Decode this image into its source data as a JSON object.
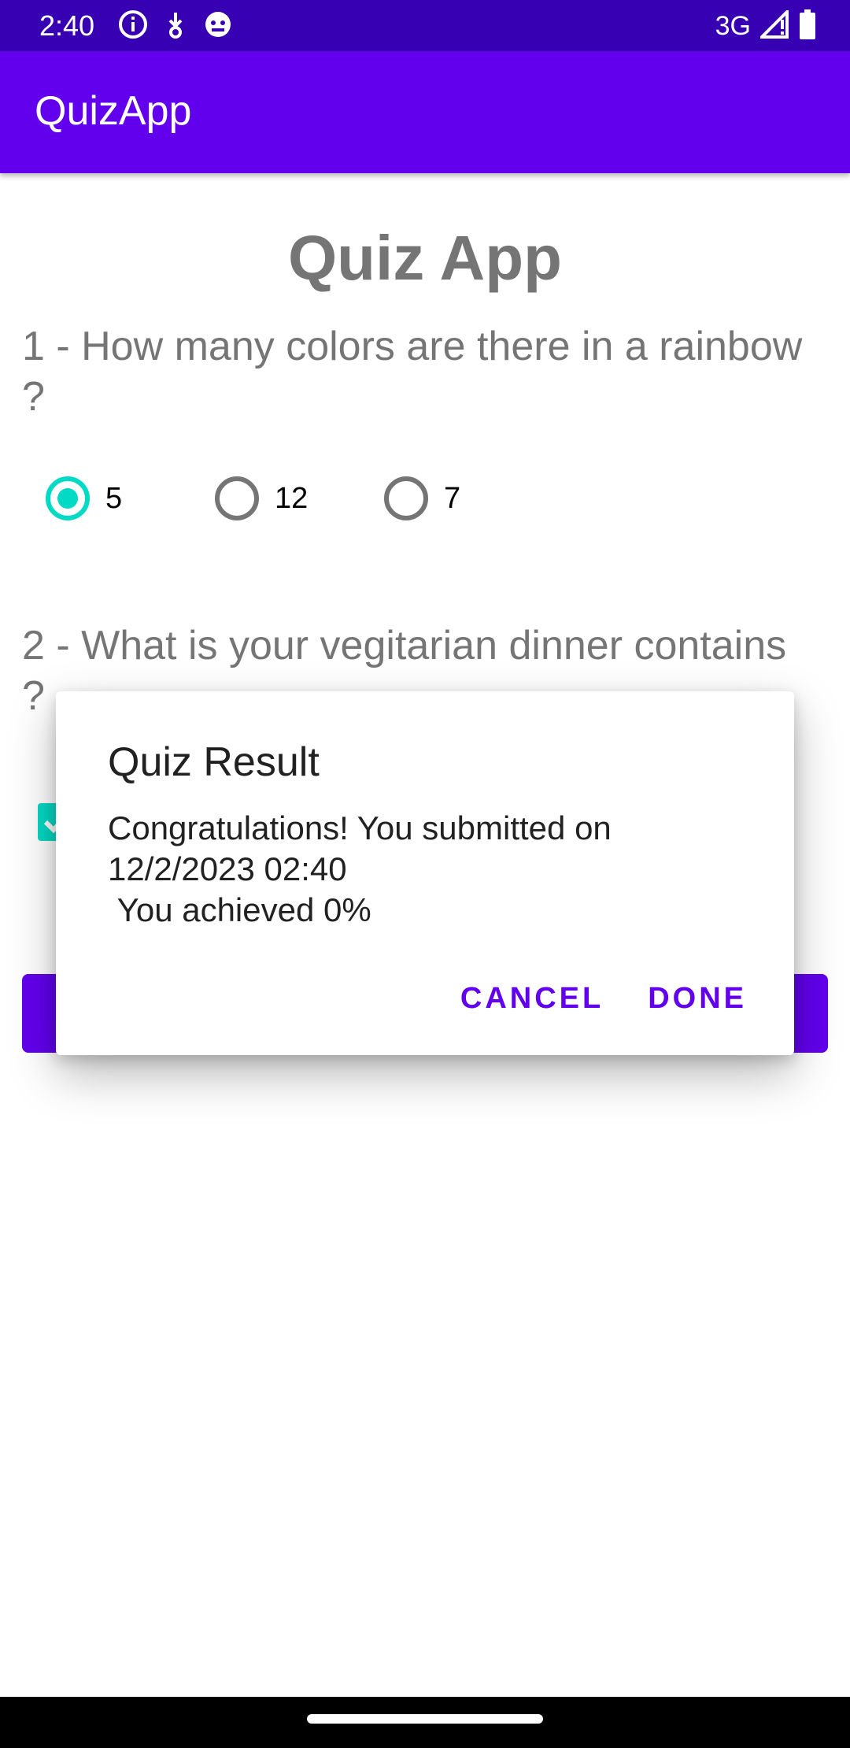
{
  "status_bar": {
    "time": "2:40",
    "network": "3G",
    "icons": [
      "info-icon",
      "download-icon",
      "android-debug-icon",
      "signal-icon",
      "battery-icon"
    ]
  },
  "app_bar": {
    "title": "QuizApp"
  },
  "main": {
    "heading": "Quiz App",
    "question1": {
      "text": "1 - How many colors are there in a rainbow ?",
      "options": [
        "5",
        "12",
        "7"
      ],
      "selected": "5"
    },
    "question2": {
      "text": "2 - What is your vegitarian dinner contains ?"
    }
  },
  "dialog": {
    "title": "Quiz Result",
    "message": "Congratulations! You submitted on\n12/2/2023 02:40\n You achieved 0%",
    "cancel_label": "CANCEL",
    "done_label": "DONE"
  },
  "colors": {
    "primary": "#6200ee",
    "primary_dark": "#3700b3",
    "accent": "#03dac5",
    "text_secondary": "#757575"
  }
}
